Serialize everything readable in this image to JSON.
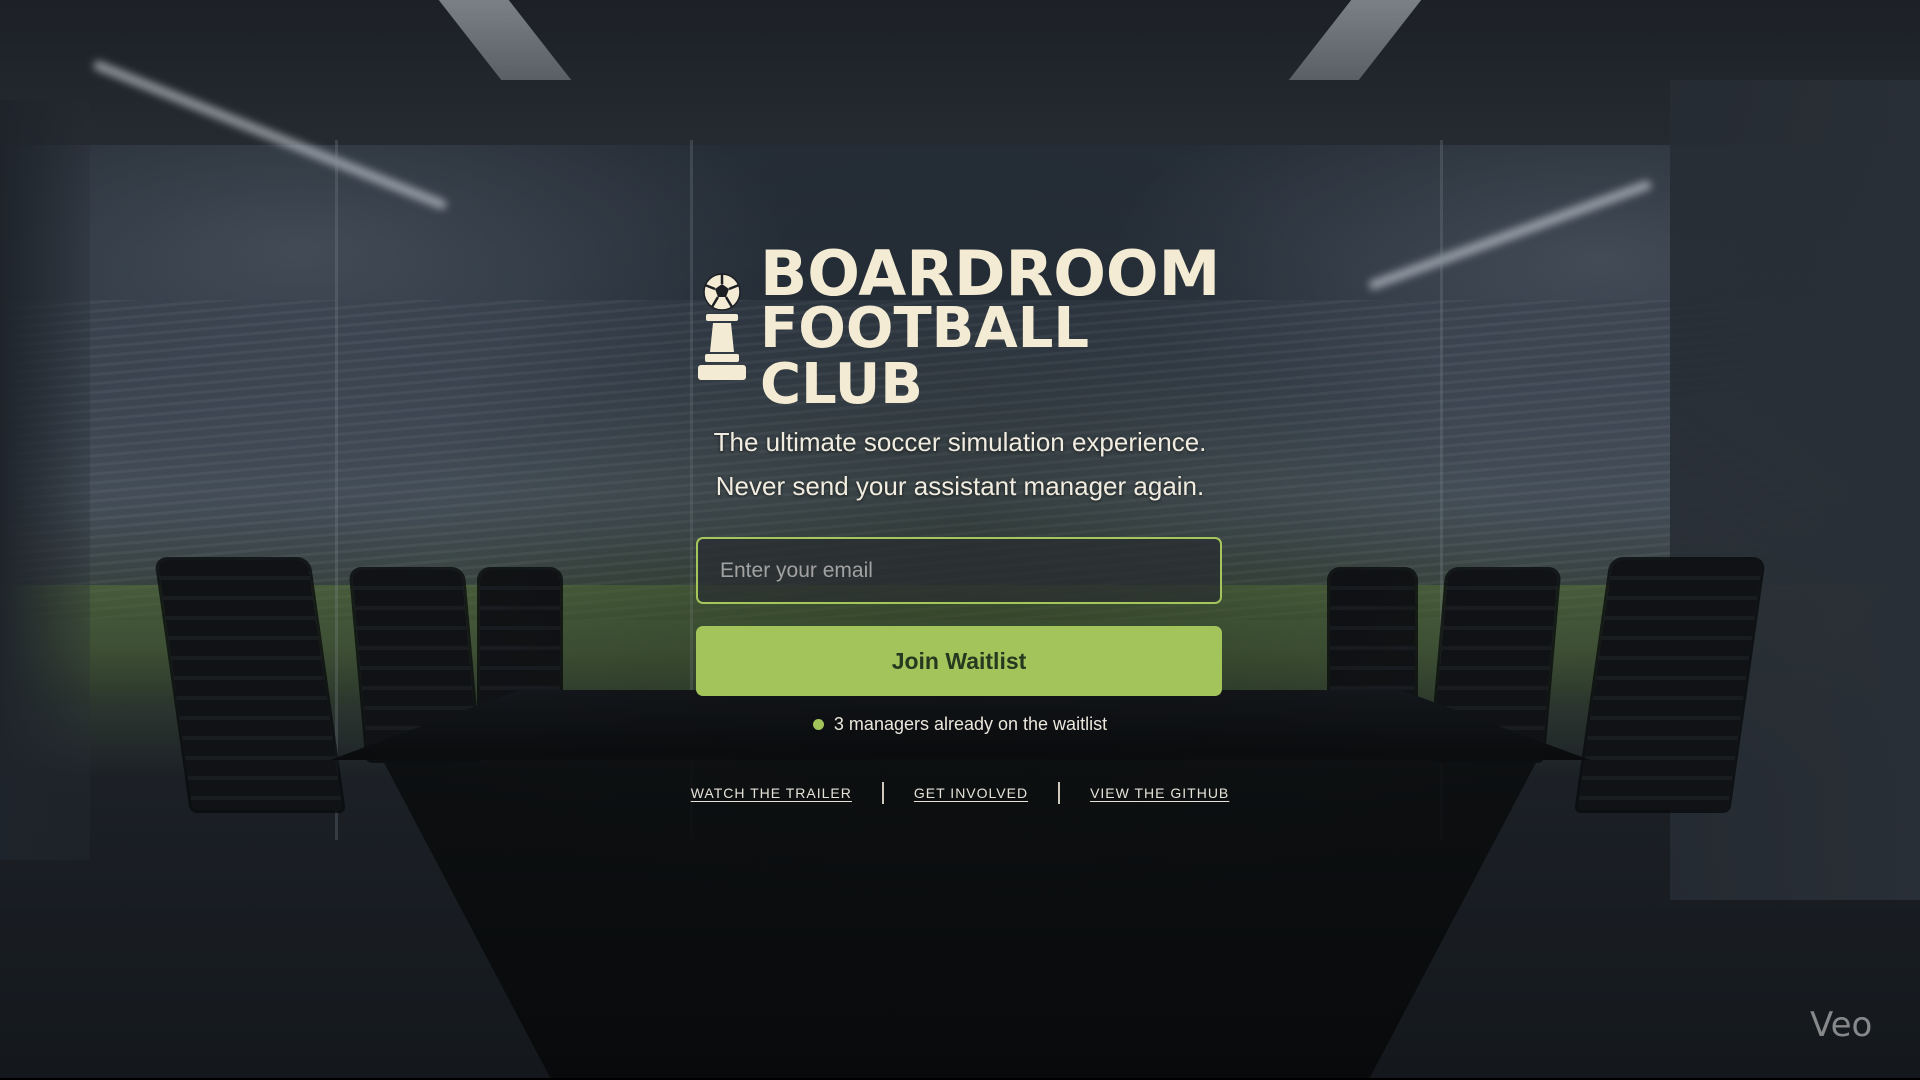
{
  "logo": {
    "line1": "BOARDROOM",
    "line2": "FOOTBALL CLUB",
    "icon": "chess-pawn-soccer-ball-icon",
    "color": "#f3ebd3"
  },
  "tagline": {
    "line1": "The ultimate soccer simulation experience.",
    "line2": "Never send your assistant manager again."
  },
  "form": {
    "email_placeholder": "Enter your email",
    "email_value": "",
    "submit_label": "Join Waitlist"
  },
  "waitlist": {
    "status_text": "3 managers already on the waitlist"
  },
  "links": {
    "trailer": "WATCH THE TRAILER",
    "involved": "GET INVOLVED",
    "github": "VIEW THE GITHUB"
  },
  "watermark": "Veo",
  "colors": {
    "accent": "#a3c45a",
    "text": "#f1ece0",
    "button_text": "#26381f"
  }
}
